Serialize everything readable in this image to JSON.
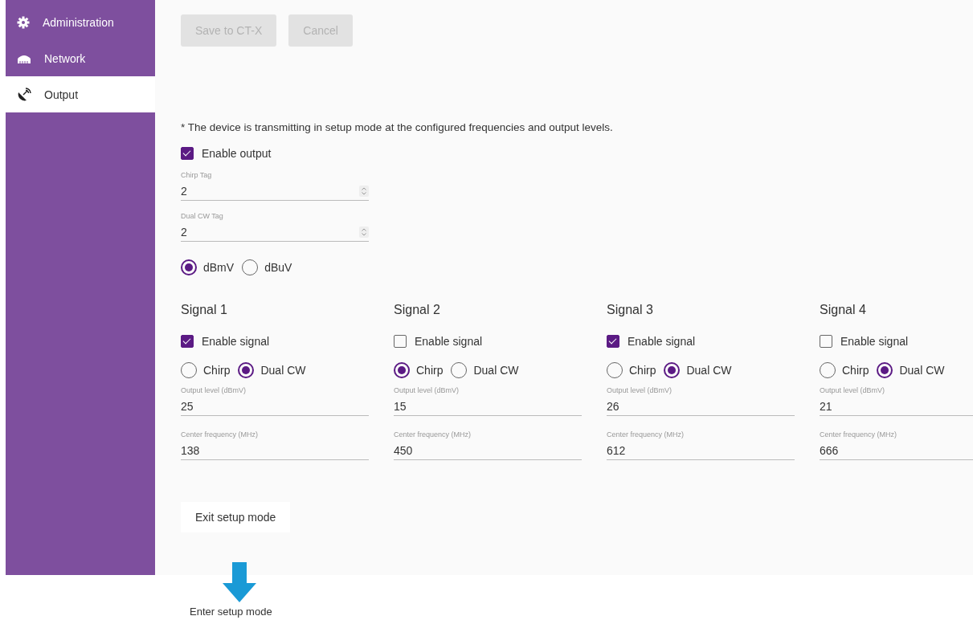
{
  "sidebar": {
    "items": [
      {
        "label": "Administration",
        "selected": false
      },
      {
        "label": "Network",
        "selected": false
      },
      {
        "label": "Output",
        "selected": true
      }
    ]
  },
  "toolbar": {
    "buttons": [
      {
        "label": "Save to CT-X",
        "disabled": true
      },
      {
        "label": "Cancel",
        "disabled": true
      }
    ]
  },
  "note": "* The device is transmitting in setup mode at the configured frequencies and output levels.",
  "enable_output": {
    "label": "Enable output",
    "checked": true
  },
  "tag_fields": [
    {
      "label": "Chirp Tag",
      "value": "2"
    },
    {
      "label": "Dual CW Tag",
      "value": "2"
    }
  ],
  "units": [
    {
      "label": "dBmV",
      "selected": true
    },
    {
      "label": "dBuV",
      "selected": false
    }
  ],
  "signals": [
    {
      "title": "Signal 1",
      "enable": {
        "label": "Enable signal",
        "checked": true
      },
      "modes": [
        {
          "label": "Chirp",
          "selected": false
        },
        {
          "label": "Dual CW",
          "selected": true
        }
      ],
      "fields": [
        {
          "label": "Output level (dBmV)",
          "value": "25"
        },
        {
          "label": "Center frequency (MHz)",
          "value": "138"
        }
      ]
    },
    {
      "title": "Signal 2",
      "enable": {
        "label": "Enable signal",
        "checked": false
      },
      "modes": [
        {
          "label": "Chirp",
          "selected": true
        },
        {
          "label": "Dual CW",
          "selected": false
        }
      ],
      "fields": [
        {
          "label": "Output level (dBmV)",
          "value": "15"
        },
        {
          "label": "Center frequency (MHz)",
          "value": "450"
        }
      ]
    },
    {
      "title": "Signal 3",
      "enable": {
        "label": "Enable signal",
        "checked": true
      },
      "modes": [
        {
          "label": "Chirp",
          "selected": false
        },
        {
          "label": "Dual CW",
          "selected": true
        }
      ],
      "fields": [
        {
          "label": "Output level (dBmV)",
          "value": "26"
        },
        {
          "label": "Center frequency (MHz)",
          "value": "612"
        }
      ]
    },
    {
      "title": "Signal 4",
      "enable": {
        "label": "Enable signal",
        "checked": false
      },
      "modes": [
        {
          "label": "Chirp",
          "selected": false
        },
        {
          "label": "Dual CW",
          "selected": true
        }
      ],
      "fields": [
        {
          "label": "Output level (dBmV)",
          "value": "21"
        },
        {
          "label": "Center frequency (MHz)",
          "value": "666"
        }
      ]
    }
  ],
  "exit_button": {
    "label": "Exit setup mode"
  },
  "annotation": {
    "label": "Enter setup mode"
  }
}
